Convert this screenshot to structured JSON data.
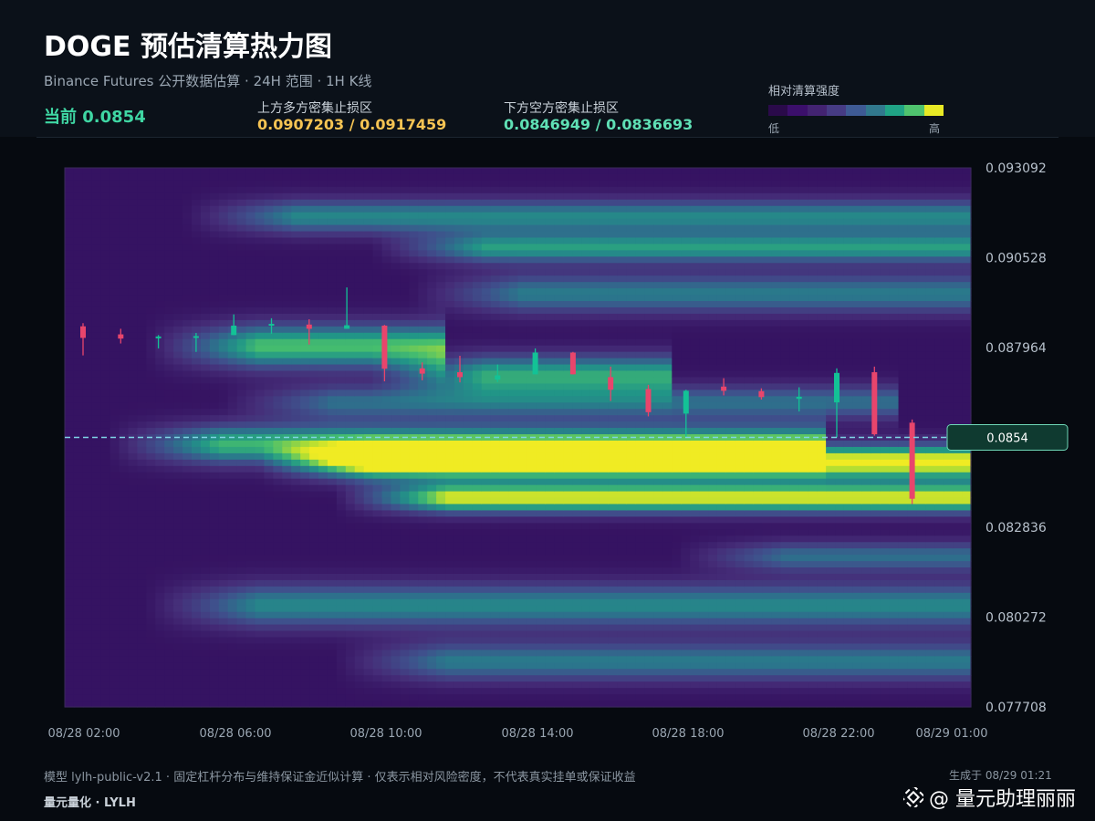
{
  "header": {
    "title": "DOGE 预估清算热力图",
    "subtitle": "Binance Futures 公开数据估算  ·  24H 范围  ·  1H K线",
    "current": "当前 0.0854",
    "upper_zone_label": "上方多方密集止损区",
    "upper_zone_value": "0.0907203 / 0.0917459",
    "lower_zone_label": "下方空方密集止损区",
    "lower_zone_value": "0.0846949 / 0.0836693"
  },
  "legend": {
    "title": "相对清算强度",
    "low": "低",
    "high": "高",
    "colors": [
      "#2a0a4a",
      "#3b0f6b",
      "#432371",
      "#463b84",
      "#3e5a94",
      "#31788d",
      "#20a385",
      "#4fc36e",
      "#e8e925"
    ]
  },
  "colors": {
    "up_candle": "#13c296",
    "down_candle": "#e8456c",
    "current_line": "#7fd4e6",
    "upper_value": "#f6c453",
    "lower_value": "#5fe0b5",
    "current_text": "#3fd6a3"
  },
  "chart_data": {
    "type": "heatmap",
    "title": "DOGE 预估清算热力图",
    "ylim": [
      0.077708,
      0.093092
    ],
    "y_ticks": [
      "0.093092",
      "0.090528",
      "0.087964",
      "0.085400",
      "0.082836",
      "0.080272",
      "0.077708"
    ],
    "y_tick_labels": [
      "0.093092",
      "0.090528",
      "0.087964",
      "",
      "0.082836",
      "0.080272",
      "0.077708"
    ],
    "x_ticks": [
      "08/28 02:00",
      "08/28 06:00",
      "08/28 10:00",
      "08/28 14:00",
      "08/28 18:00",
      "08/28 22:00",
      "08/29 01:00"
    ],
    "x_tick_index": [
      0,
      4,
      8,
      12,
      16,
      20,
      23
    ],
    "current_price": 0.0854,
    "current_price_label": "0.0854",
    "density_bands": [
      {
        "price": 0.0917,
        "width": 0.00035,
        "start": 3,
        "end": 24,
        "peak": 0.55
      },
      {
        "price": 0.0908,
        "width": 0.0003,
        "start": 8,
        "end": 24,
        "peak": 0.62
      },
      {
        "price": 0.0895,
        "width": 0.0004,
        "start": 9,
        "end": 24,
        "peak": 0.5
      },
      {
        "price": 0.088,
        "width": 0.00045,
        "start": 2,
        "end": 10,
        "peak": 0.75
      },
      {
        "price": 0.0872,
        "width": 0.0004,
        "start": 8,
        "end": 16,
        "peak": 0.65
      },
      {
        "price": 0.0864,
        "width": 0.00035,
        "start": 4,
        "end": 22,
        "peak": 0.45
      },
      {
        "price": 0.0852,
        "width": 0.0004,
        "start": 1,
        "end": 20,
        "peak": 0.72
      },
      {
        "price": 0.0846949,
        "width": 0.00035,
        "start": 5,
        "end": 24,
        "peak": 1.0
      },
      {
        "price": 0.0836693,
        "width": 0.0003,
        "start": 7,
        "end": 24,
        "peak": 0.92
      },
      {
        "price": 0.082,
        "width": 0.0003,
        "start": 16,
        "end": 24,
        "peak": 0.45
      },
      {
        "price": 0.0806,
        "width": 0.00045,
        "start": 2,
        "end": 24,
        "peak": 0.55
      },
      {
        "price": 0.079,
        "width": 0.0004,
        "start": 7,
        "end": 24,
        "peak": 0.5
      }
    ],
    "candles": [
      {
        "t": "08/28 02:00",
        "o": 0.08857,
        "h": 0.08866,
        "l": 0.08774,
        "c": 0.08824
      },
      {
        "t": "08/28 03:00",
        "o": 0.08834,
        "h": 0.0885,
        "l": 0.08808,
        "c": 0.08822
      },
      {
        "t": "08/28 04:00",
        "o": 0.08824,
        "h": 0.08832,
        "l": 0.08794,
        "c": 0.08828
      },
      {
        "t": "08/28 05:00",
        "o": 0.08824,
        "h": 0.08838,
        "l": 0.08784,
        "c": 0.08829
      },
      {
        "t": "08/28 06:00",
        "o": 0.08832,
        "h": 0.08891,
        "l": 0.08832,
        "c": 0.08859
      },
      {
        "t": "08/28 07:00",
        "o": 0.08862,
        "h": 0.0888,
        "l": 0.08836,
        "c": 0.08864
      },
      {
        "t": "08/28 08:00",
        "o": 0.08862,
        "h": 0.08877,
        "l": 0.08805,
        "c": 0.0885
      },
      {
        "t": "08/28 09:00",
        "o": 0.0885,
        "h": 0.08968,
        "l": 0.0885,
        "c": 0.0886
      },
      {
        "t": "08/28 10:00",
        "o": 0.08859,
        "h": 0.08861,
        "l": 0.087,
        "c": 0.08736
      },
      {
        "t": "08/28 11:00",
        "o": 0.08737,
        "h": 0.08754,
        "l": 0.08703,
        "c": 0.08722
      },
      {
        "t": "08/28 12:00",
        "o": 0.08726,
        "h": 0.08773,
        "l": 0.08697,
        "c": 0.08712
      },
      {
        "t": "08/28 13:00",
        "o": 0.08705,
        "h": 0.08748,
        "l": 0.08698,
        "c": 0.08717
      },
      {
        "t": "08/28 14:00",
        "o": 0.0872,
        "h": 0.08794,
        "l": 0.0872,
        "c": 0.08782
      },
      {
        "t": "08/28 15:00",
        "o": 0.08782,
        "h": 0.08784,
        "l": 0.0872,
        "c": 0.0872
      },
      {
        "t": "08/28 16:00",
        "o": 0.08712,
        "h": 0.08742,
        "l": 0.08644,
        "c": 0.08676
      },
      {
        "t": "08/28 17:00",
        "o": 0.08678,
        "h": 0.0869,
        "l": 0.086,
        "c": 0.08612
      },
      {
        "t": "08/28 18:00",
        "o": 0.08608,
        "h": 0.08676,
        "l": 0.0854,
        "c": 0.08673
      },
      {
        "t": "08/28 19:00",
        "o": 0.08685,
        "h": 0.08709,
        "l": 0.0866,
        "c": 0.08673
      },
      {
        "t": "08/28 20:00",
        "o": 0.08672,
        "h": 0.0868,
        "l": 0.08648,
        "c": 0.08655
      },
      {
        "t": "08/28 21:00",
        "o": 0.0865,
        "h": 0.08683,
        "l": 0.08614,
        "c": 0.08656
      },
      {
        "t": "08/28 22:00",
        "o": 0.0864,
        "h": 0.08737,
        "l": 0.0854,
        "c": 0.08724
      },
      {
        "t": "08/28 23:00",
        "o": 0.08726,
        "h": 0.08742,
        "l": 0.08545,
        "c": 0.08549
      },
      {
        "t": "08/29 00:00",
        "o": 0.08582,
        "h": 0.08591,
        "l": 0.0835,
        "c": 0.08365
      }
    ]
  },
  "footer": {
    "note": "模型 lylh-public-v2.1  ·  固定杠杆分布与维持保证金近似计算  ·  仅表示相对风险密度，不代表真实挂单或保证收益",
    "brand": "量元量化  ·  LYLH",
    "generated": "生成于 08/29 01:21",
    "watermark": "@ 量元助理丽丽"
  }
}
